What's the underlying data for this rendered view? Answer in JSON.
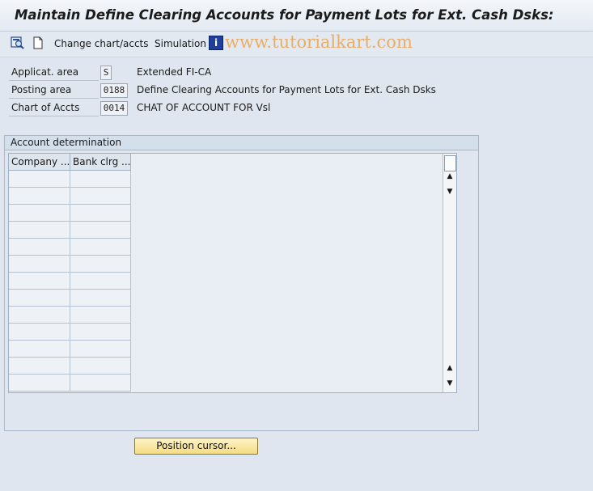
{
  "window": {
    "title": "Maintain Define Clearing Accounts for Payment Lots for Ext. Cash Dsks:"
  },
  "toolbar": {
    "icon_display_change": "display-change-icon",
    "icon_new": "new-document-icon",
    "change_chart_label": "Change chart/accts",
    "simulation_label": "Simulation",
    "info_icon_glyph": "i",
    "watermark": "www.tutorialkart.com"
  },
  "fields": [
    {
      "label": "Applicat. area",
      "value": "S",
      "description": "Extended FI-CA"
    },
    {
      "label": "Posting area",
      "value": "0188",
      "description": "Define Clearing Accounts for Payment Lots for Ext. Cash Dsks"
    },
    {
      "label": "Chart of Accts",
      "value": "0014",
      "description": "CHAT OF ACCOUNT FOR Vsl"
    }
  ],
  "account_determination": {
    "title": "Account determination",
    "columns": [
      "Company ...",
      "Bank clrg ..."
    ]
  },
  "buttons": {
    "position_cursor": "Position cursor..."
  },
  "colors": {
    "button_bg": "#f4dc83",
    "info_icon": "#1f3f9a",
    "watermark": "#e9ad69"
  }
}
